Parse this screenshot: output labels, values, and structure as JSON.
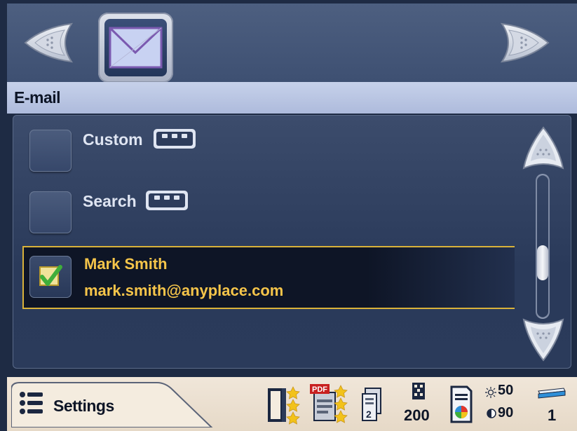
{
  "header": {
    "mail_icon": "envelope-icon",
    "back_icon": "back-arrow-icon",
    "forward_icon": "forward-arrow-icon"
  },
  "title": "E-mail",
  "list": {
    "items": [
      {
        "label": "Custom",
        "checked": false,
        "more_icon": "more-dots-icon"
      },
      {
        "label": "Search",
        "checked": false,
        "more_icon": "more-dots-icon"
      }
    ],
    "selected": {
      "name": "Mark Smith",
      "email": "mark.smith@anyplace.com",
      "checked": true,
      "check_icon": "checkmark-icon"
    }
  },
  "footer": {
    "settings_label": "Settings",
    "settings_icon": "list-icon",
    "resolution": "200",
    "brightness": "50",
    "contrast": "90",
    "copies": "1",
    "icons": [
      "document-feeder-icon",
      "pdf-output-icon",
      "two-sided-icon",
      "resolution-icon",
      "color-document-icon",
      "brightness-icon",
      "contrast-icon",
      "paper-tray-icon"
    ]
  },
  "colors": {
    "background": "#1e2b44",
    "title_band": "#c6d1ea",
    "selection_border": "#d9b23a",
    "selection_text": "#f6c54a",
    "footer": "#f0e6d9"
  }
}
